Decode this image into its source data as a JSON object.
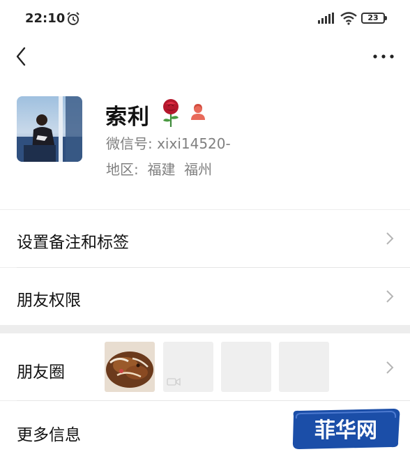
{
  "status_bar": {
    "time": "22:10",
    "battery": "23"
  },
  "profile": {
    "name": "索利",
    "wechat_id": "微信号: xixi14520-",
    "region": "地区:  福建  福州"
  },
  "menu": {
    "remark_tags": "设置备注和标签",
    "permissions": "朋友权限",
    "moments": "朋友圈",
    "more_info": "更多信息"
  },
  "watermark": {
    "text": "菲华网"
  },
  "colors": {
    "accent_blue": "#1b4ea8",
    "background": "#ededed"
  }
}
